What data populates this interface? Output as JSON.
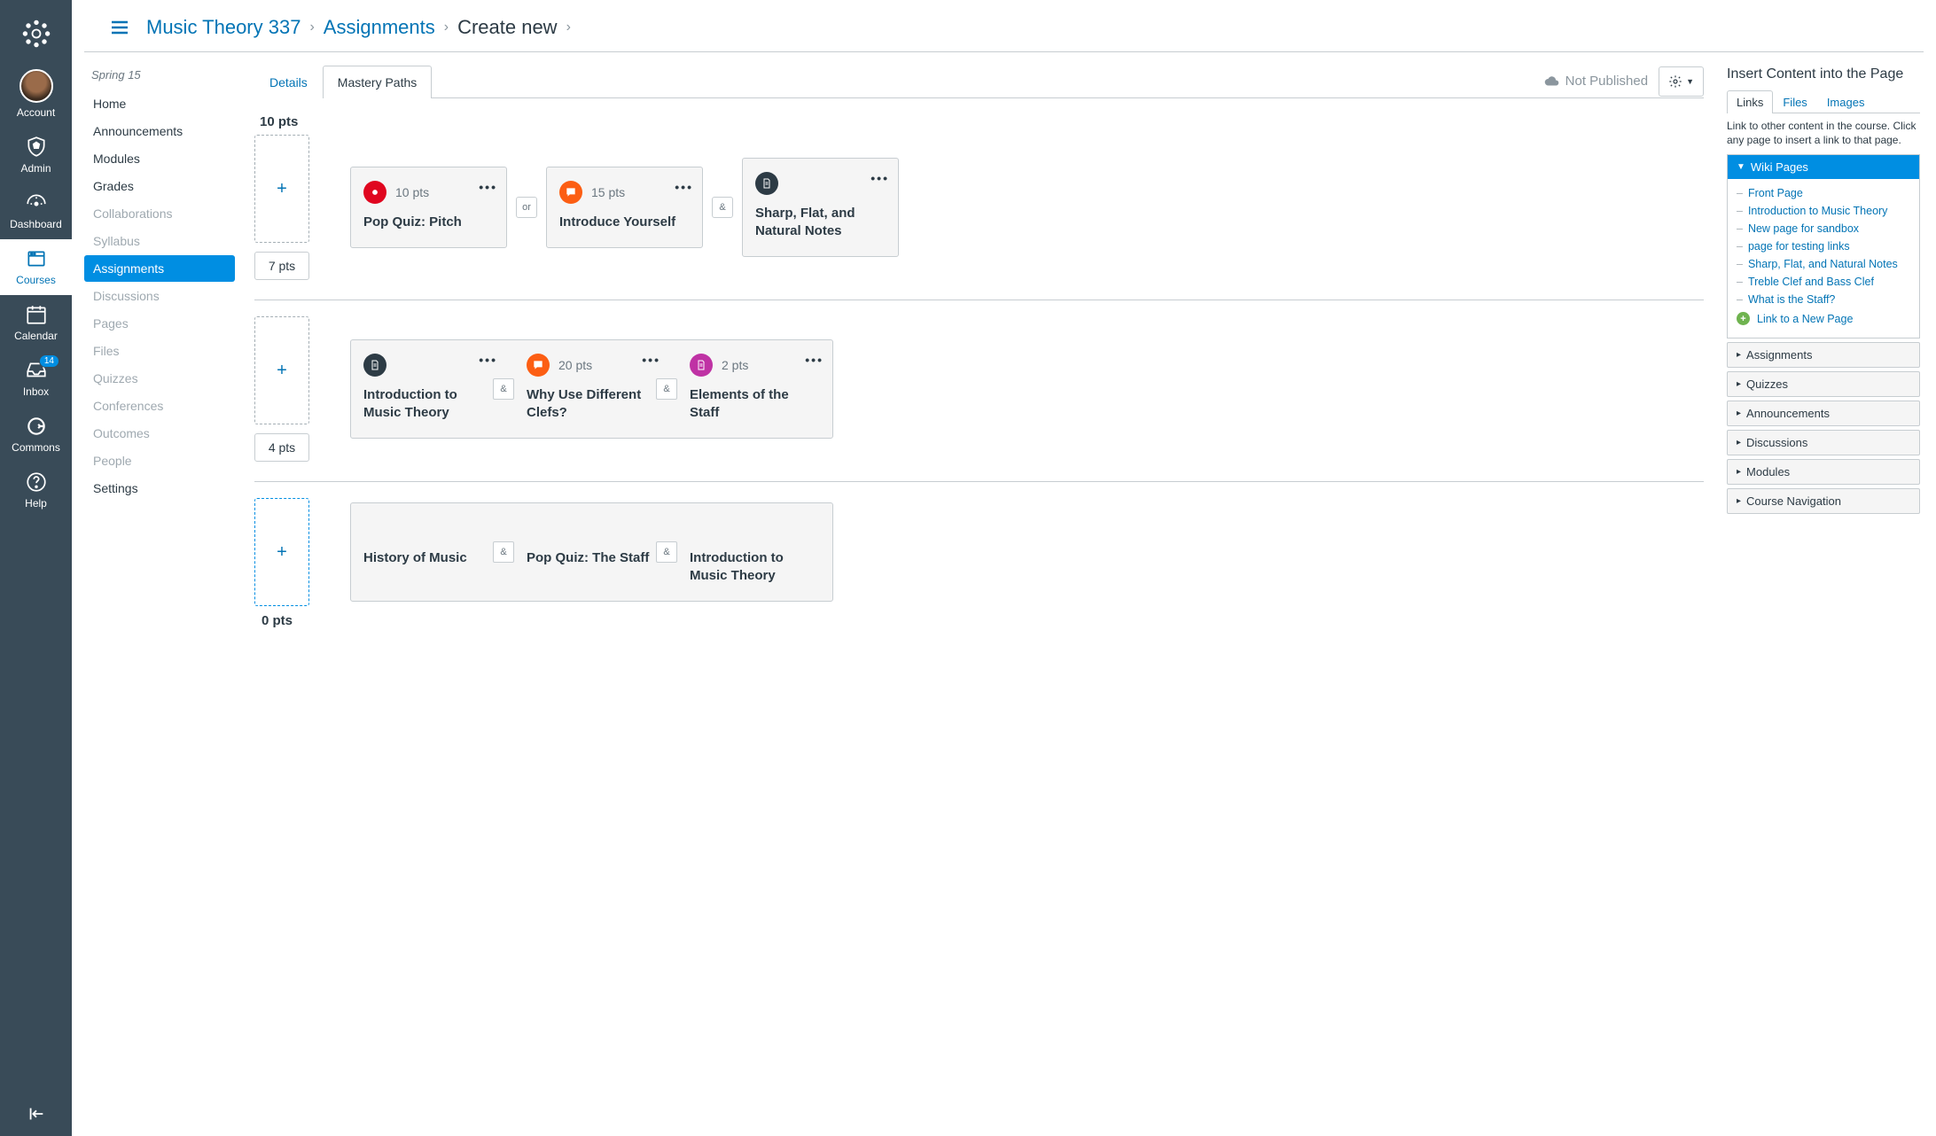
{
  "global_nav": {
    "items": [
      {
        "label": "Account"
      },
      {
        "label": "Admin"
      },
      {
        "label": "Dashboard"
      },
      {
        "label": "Courses"
      },
      {
        "label": "Calendar"
      },
      {
        "label": "Inbox",
        "badge": "14"
      },
      {
        "label": "Commons"
      },
      {
        "label": "Help"
      }
    ]
  },
  "breadcrumb": {
    "course": "Music Theory 337",
    "section": "Assignments",
    "current": "Create new"
  },
  "course_nav": {
    "term": "Spring 15",
    "items": [
      {
        "label": "Home",
        "dim": false
      },
      {
        "label": "Announcements",
        "dim": false
      },
      {
        "label": "Modules",
        "dim": false
      },
      {
        "label": "Grades",
        "dim": false
      },
      {
        "label": "Collaborations",
        "dim": true
      },
      {
        "label": "Syllabus",
        "dim": true
      },
      {
        "label": "Assignments",
        "dim": false,
        "active": true
      },
      {
        "label": "Discussions",
        "dim": true
      },
      {
        "label": "Pages",
        "dim": true
      },
      {
        "label": "Files",
        "dim": true
      },
      {
        "label": "Quizzes",
        "dim": true
      },
      {
        "label": "Conferences",
        "dim": true
      },
      {
        "label": "Outcomes",
        "dim": true
      },
      {
        "label": "People",
        "dim": true
      },
      {
        "label": "Settings",
        "dim": false
      }
    ]
  },
  "tabs": {
    "details": "Details",
    "mastery": "Mastery Paths"
  },
  "status": {
    "not_published": "Not Published"
  },
  "paths": [
    {
      "top_pts": "10 pts",
      "slot_pts": "7 pts",
      "groups": [
        {
          "cards": [
            {
              "icon": "red",
              "iconType": "quiz",
              "pts": "10 pts",
              "title": "Pop Quiz: Pitch"
            }
          ]
        },
        {
          "conn": "or",
          "cards": [
            {
              "icon": "orange",
              "iconType": "discussion",
              "pts": "15 pts",
              "title": "Introduce Yourself"
            }
          ]
        },
        {
          "conn": "&",
          "cards": [
            {
              "icon": "dark",
              "iconType": "page",
              "pts": "",
              "title": "Sharp, Flat, and Natural Notes"
            }
          ]
        }
      ]
    },
    {
      "slot_pts": "4 pts",
      "groups": [
        {
          "cards": [
            {
              "icon": "dark",
              "iconType": "page",
              "pts": "",
              "title": "Introduction to Music Theory"
            },
            {
              "icon": "orange",
              "iconType": "discussion",
              "pts": "20 pts",
              "title": "Why Use Different Clefs?"
            },
            {
              "icon": "purple",
              "iconType": "page",
              "pts": "2 pts",
              "title": "Elements of the Staff"
            }
          ],
          "inner_conn": "&"
        }
      ]
    },
    {
      "bottom_pts": "0 pts",
      "active_slot": true,
      "groups": [
        {
          "cards": [
            {
              "title": "History of Music"
            },
            {
              "title": "Pop Quiz: The Staff"
            },
            {
              "title": "Introduction to Music Theory"
            }
          ],
          "inner_conn": "&"
        }
      ]
    }
  ],
  "rsidebar": {
    "title": "Insert Content into the Page",
    "tabs": {
      "links": "Links",
      "files": "Files",
      "images": "Images"
    },
    "hint": "Link to other content in the course. Click any page to insert a link to that page.",
    "wiki_header": "Wiki Pages",
    "wiki_items": [
      "Front Page",
      "Introduction to Music Theory",
      "New page for sandbox",
      "page for testing links",
      "Sharp, Flat, and Natural Notes",
      "Treble Clef and Bass Clef",
      "What is the Staff?"
    ],
    "new_link": "Link to a New Page",
    "sections": [
      "Assignments",
      "Quizzes",
      "Announcements",
      "Discussions",
      "Modules",
      "Course Navigation"
    ]
  }
}
